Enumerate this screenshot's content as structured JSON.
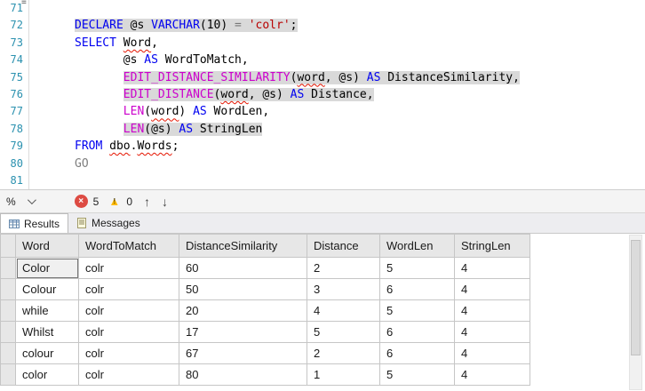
{
  "editor": {
    "lines": [
      {
        "num": "71",
        "indent": "",
        "hl": false,
        "segs": []
      },
      {
        "num": "72",
        "indent": "",
        "hl": true,
        "segs": [
          [
            "kw",
            "DECLARE"
          ],
          [
            "id",
            " @s "
          ],
          [
            "kw",
            "VARCHAR"
          ],
          [
            "id",
            "(10) "
          ],
          [
            "op",
            "= "
          ],
          [
            "str",
            "'colr'"
          ],
          [
            "id",
            ";"
          ]
        ]
      },
      {
        "num": "73",
        "indent": "",
        "hl": false,
        "segs": [
          [
            "kw",
            "SELECT"
          ],
          [
            "id",
            " "
          ],
          [
            "errw",
            "Word"
          ],
          [
            "id",
            ","
          ]
        ]
      },
      {
        "num": "74",
        "indent": "       ",
        "hl": false,
        "segs": [
          [
            "id",
            "@s "
          ],
          [
            "kw",
            "AS"
          ],
          [
            "id",
            " WordToMatch,"
          ]
        ]
      },
      {
        "num": "75",
        "indent": "       ",
        "hl": true,
        "segs": [
          [
            "fn",
            "EDIT_DISTANCE_SIMILARITY"
          ],
          [
            "id",
            "("
          ],
          [
            "errw",
            "word"
          ],
          [
            "id",
            ", @s) "
          ],
          [
            "kw",
            "AS"
          ],
          [
            "id",
            " DistanceSimilarity,"
          ]
        ]
      },
      {
        "num": "76",
        "indent": "       ",
        "hl": true,
        "segs": [
          [
            "fn",
            "EDIT_DISTANCE"
          ],
          [
            "id",
            "("
          ],
          [
            "errw",
            "word"
          ],
          [
            "id",
            ", @s) "
          ],
          [
            "kw",
            "AS"
          ],
          [
            "id",
            " Distance,"
          ]
        ]
      },
      {
        "num": "77",
        "indent": "       ",
        "hl": false,
        "segs": [
          [
            "fn",
            "LEN"
          ],
          [
            "id",
            "("
          ],
          [
            "errw",
            "word"
          ],
          [
            "id",
            ") "
          ],
          [
            "kw",
            "AS"
          ],
          [
            "id",
            " WordLen,"
          ]
        ]
      },
      {
        "num": "78",
        "indent": "       ",
        "hl": true,
        "segs": [
          [
            "fn",
            "LEN"
          ],
          [
            "id",
            "(@s) "
          ],
          [
            "kw",
            "AS"
          ],
          [
            "id",
            " StringLen"
          ]
        ]
      },
      {
        "num": "79",
        "indent": "",
        "hl": false,
        "segs": [
          [
            "kw",
            "FROM"
          ],
          [
            "id",
            " "
          ],
          [
            "errw",
            "dbo"
          ],
          [
            "id",
            "."
          ],
          [
            "errw",
            "Words"
          ],
          [
            "id",
            ";"
          ]
        ]
      },
      {
        "num": "80",
        "indent": "",
        "hl": false,
        "segs": [
          [
            "go",
            "GO"
          ]
        ]
      },
      {
        "num": "81",
        "indent": "",
        "hl": false,
        "segs": []
      }
    ]
  },
  "statusbar": {
    "zoom_label": "%",
    "error_count": "5",
    "warning_count": "0",
    "icons": {
      "error_x": "×",
      "warning_triangle": "▲",
      "warning_bang": "!",
      "arrow_up": "↑",
      "arrow_down": "↓",
      "editor_marker": "≡"
    }
  },
  "tabs": {
    "results": "Results",
    "messages": "Messages"
  },
  "grid": {
    "columns": [
      "Word",
      "WordToMatch",
      "DistanceSimilarity",
      "Distance",
      "WordLen",
      "StringLen"
    ],
    "rows": [
      [
        "Color",
        "colr",
        "60",
        "2",
        "5",
        "4"
      ],
      [
        "Colour",
        "colr",
        "50",
        "3",
        "6",
        "4"
      ],
      [
        "while",
        "colr",
        "20",
        "4",
        "5",
        "4"
      ],
      [
        "Whilst",
        "colr",
        "17",
        "5",
        "6",
        "4"
      ],
      [
        "colour",
        "colr",
        "67",
        "2",
        "6",
        "4"
      ],
      [
        "color",
        "colr",
        "80",
        "1",
        "5",
        "4"
      ]
    ],
    "selected": {
      "row": 0,
      "col": 0
    }
  },
  "colors": {
    "keyword": "#0000F0",
    "function": "#CC00CC",
    "string": "#B80000",
    "operator": "#777777",
    "identifier": "#000000",
    "batch_separator": "#7F7F7F",
    "line_number": "#2B91AF",
    "statement_highlight": "#D9D9D9",
    "squiggle": "#E51400",
    "error_badge": "#DD4B43",
    "warning_yellow": "#FFB900"
  }
}
